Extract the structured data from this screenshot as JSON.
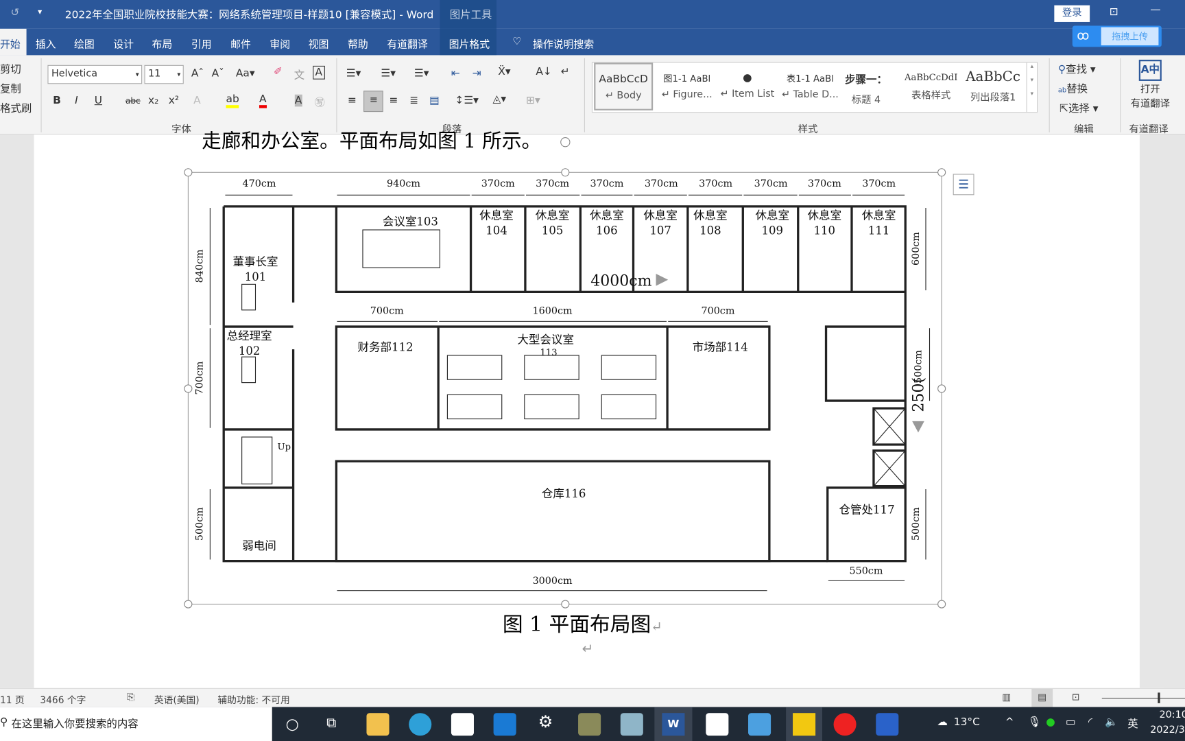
{
  "titlebar": {
    "title": "2022年全国职业院校技能大赛：网络系统管理项目-样题10 [兼容模式]  -  Word",
    "context_tab": "图片工具",
    "login": "登录",
    "upload": "拖拽上传"
  },
  "tabs": [
    "开始",
    "插入",
    "绘图",
    "设计",
    "布局",
    "引用",
    "邮件",
    "审阅",
    "视图",
    "帮助",
    "有道翻译",
    "图片格式"
  ],
  "search_hint": "操作说明搜索",
  "ribbon": {
    "clipboard": [
      "剪切",
      "复制",
      "格式刷"
    ],
    "font_name": "Helvetica",
    "font_size": "11",
    "groups": {
      "font": "字体",
      "paragraph": "段落",
      "styles": "样式",
      "edit": "编辑",
      "youdao": "有道翻译"
    },
    "styles": [
      {
        "preview": "AaBbCcD",
        "name": "↵ Body"
      },
      {
        "preview": "图1-1  AaBl",
        "name": "↵ Figure..."
      },
      {
        "preview": "●",
        "name": "↵ Item List"
      },
      {
        "preview": "表1-1  AaBl",
        "name": "↵ Table D..."
      },
      {
        "preview": "步骤一：",
        "name": "标题 4"
      },
      {
        "preview": "AaBbCcDdI",
        "name": "表格样式"
      },
      {
        "preview": "AaBbCc",
        "name": "列出段落1"
      }
    ],
    "edit": [
      "查找",
      "替换",
      "选择"
    ],
    "youdao_open": [
      "打开",
      "有道翻译"
    ]
  },
  "document": {
    "top_line": "走廊和办公室。平面布局如图 1 所示。",
    "caption": "图 1  平面布局图",
    "floorplan": {
      "rooms": {
        "r101": [
          "董事长室",
          "101"
        ],
        "r102": [
          "总经理室",
          "102"
        ],
        "r103": "会议室103",
        "rest": [
          [
            "休息室",
            "104"
          ],
          [
            "休息室",
            "105"
          ],
          [
            "休息室",
            "106"
          ],
          [
            "休息室",
            "107"
          ],
          [
            "休息室",
            "108"
          ],
          [
            "休息室",
            "109"
          ],
          [
            "休息室",
            "110"
          ],
          [
            "休息室",
            "111"
          ]
        ],
        "r112": "财务部112",
        "r113": "大型会议室",
        "r113_num": "113",
        "r114": "市场部114",
        "r116": "仓库116",
        "r117": "仓管处117",
        "weak": "弱电间",
        "stairs": "Up"
      },
      "dims": {
        "top": [
          "470cm",
          "940cm",
          "370cm",
          "370cm",
          "370cm",
          "370cm",
          "370cm",
          "370cm",
          "370cm",
          "370cm"
        ],
        "mid": [
          "700cm",
          "1600cm",
          "700cm"
        ],
        "left": [
          "840cm",
          "700cm",
          "500cm"
        ],
        "right": [
          "600cm",
          "500cm",
          "500cm"
        ],
        "bottom": [
          "3000cm",
          "550cm"
        ],
        "overlay_h": "4000cm",
        "overlay_v": "250("
      }
    }
  },
  "status": {
    "page": "11 页",
    "words": "3466 个字",
    "lang": "英语(美国)",
    "access": "辅助功能: 不可用"
  },
  "taskbar": {
    "search": "在这里输入你要搜索的内容",
    "weather": "13°C",
    "ime": "英",
    "time": "20:10",
    "date": "2022/3"
  }
}
